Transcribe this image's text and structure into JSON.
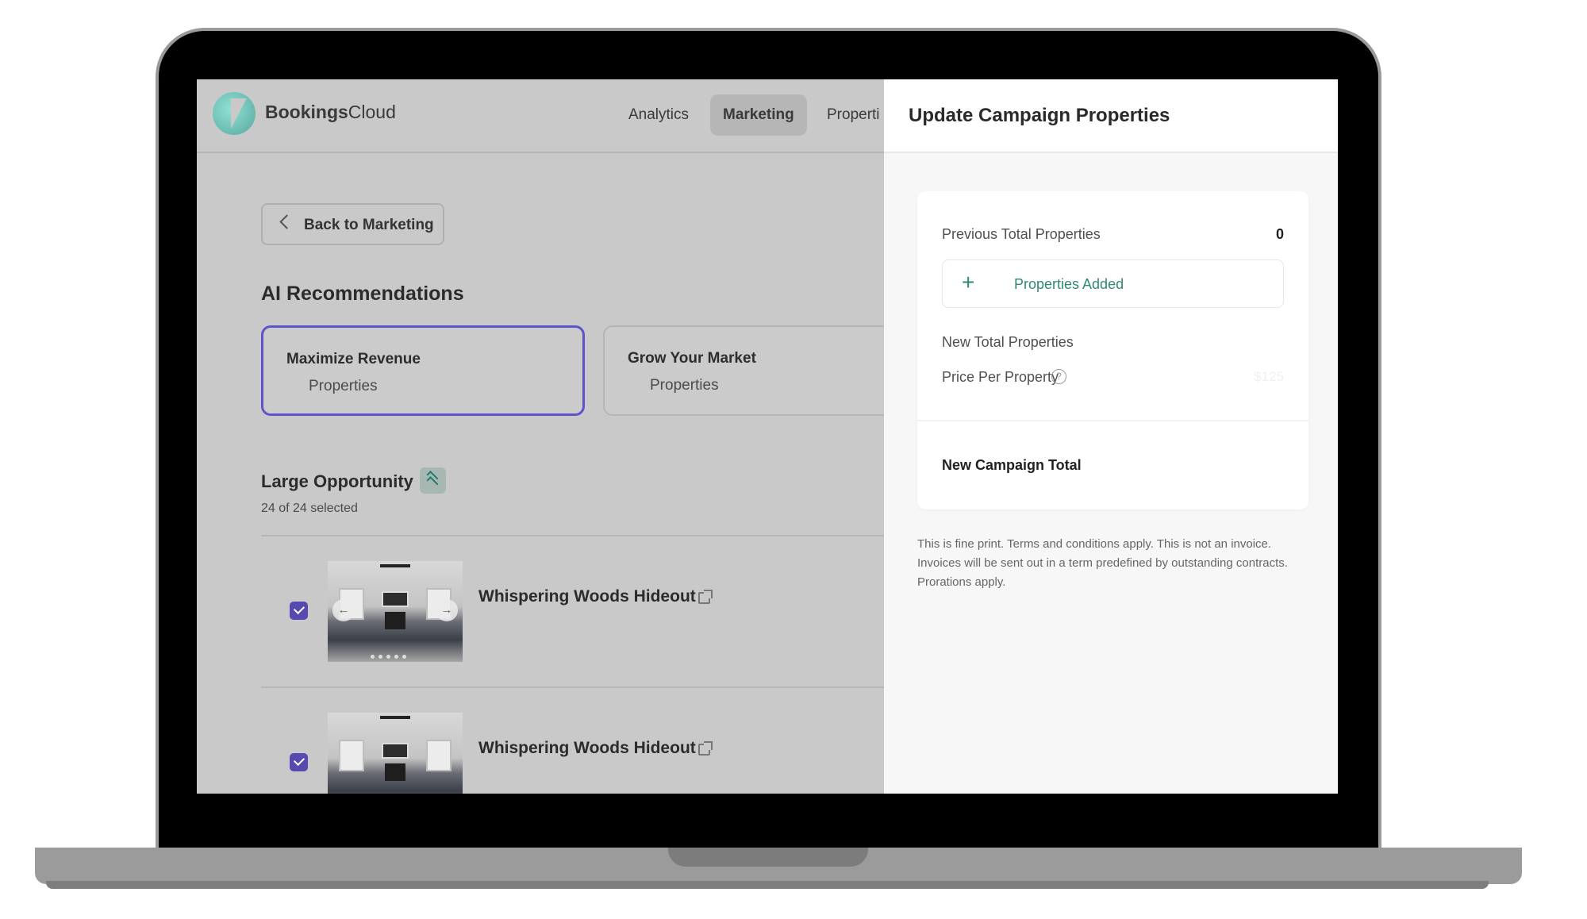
{
  "app": {
    "brand_bold": "Bookings",
    "brand_light": "Cloud",
    "nav": [
      "Analytics",
      "Marketing",
      "Properti"
    ],
    "back_label": "Back to Marketing",
    "section_title": "AI Recommendations",
    "recommendations": [
      {
        "title": "Maximize Revenue",
        "subtitle": "Properties"
      },
      {
        "title": "Grow Your Market",
        "subtitle": "Properties"
      }
    ],
    "opportunity": {
      "title": "Large Opportunity",
      "selected_text": "24 of 24 selected"
    },
    "properties": [
      {
        "name": "Whispering Woods Hideout",
        "checked": true
      },
      {
        "name": "Whispering Woods Hideout",
        "checked": true
      }
    ]
  },
  "panel": {
    "title": "Update Campaign Properties",
    "previous_total_label": "Previous Total Properties",
    "previous_total_value": "0",
    "added_label": "Properties Added",
    "new_total_label": "New Total Properties",
    "price_label": "Price Per Property",
    "price_value": "$125",
    "campaign_total_label": "New Campaign Total",
    "fine_print": "This is fine print. Terms and conditions apply. This is not an invoice. Invoices will be sent out in a term predefined by outstanding contracts. Prorations apply."
  },
  "colors": {
    "accent_purple": "#5f53c9",
    "checkbox": "#564ab0",
    "green": "#2f8a73"
  },
  "icons": [
    "logo-icon",
    "chevron-left-icon",
    "chevrons-up-icon",
    "checkbox-checked-icon",
    "external-link-icon",
    "plus-icon",
    "help-circle-icon",
    "arrow-left-icon",
    "arrow-right-icon"
  ]
}
